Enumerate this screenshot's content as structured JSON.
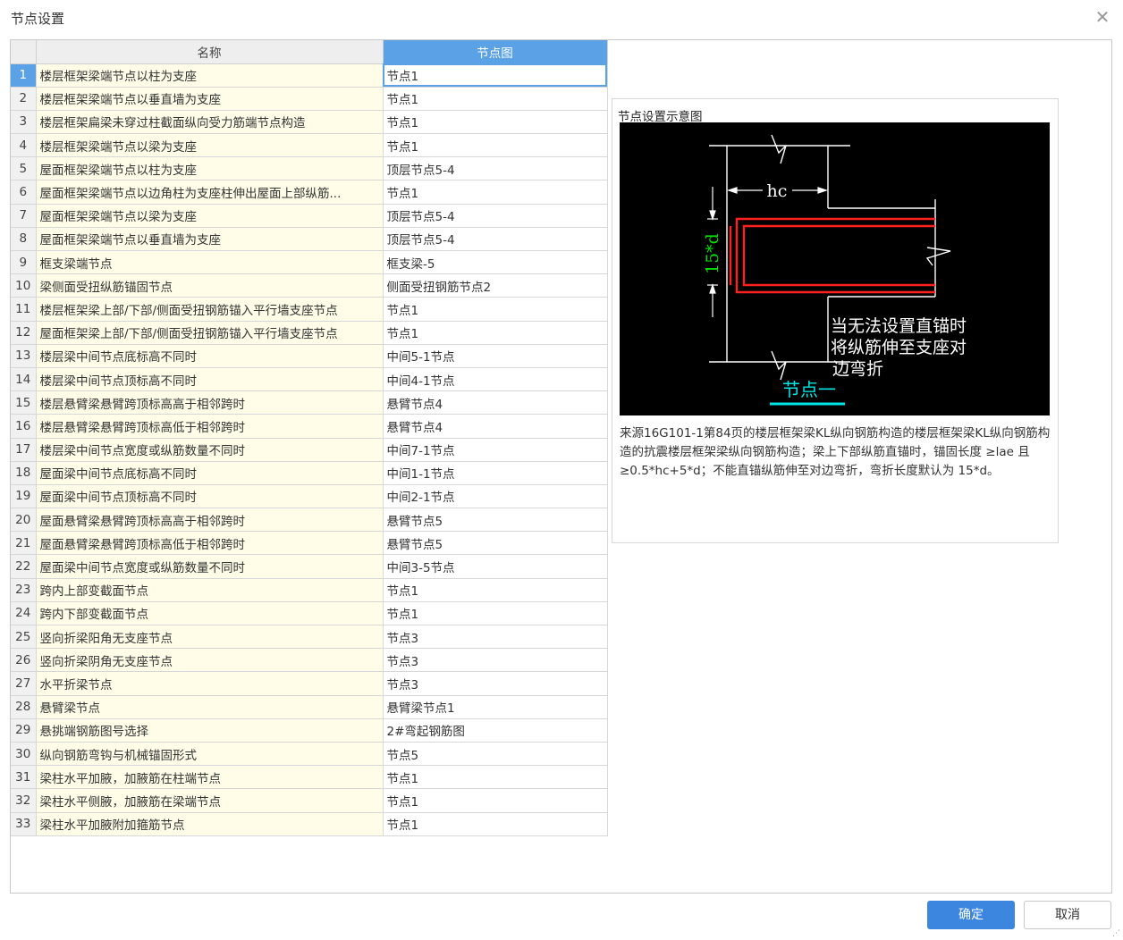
{
  "dialog": {
    "title": "节点设置"
  },
  "table": {
    "headers": {
      "name": "名称",
      "node": "节点图"
    },
    "rows": [
      {
        "no": "1",
        "name": "楼层框架梁端节点以柱为支座",
        "value": "节点1"
      },
      {
        "no": "2",
        "name": "楼层框架梁端节点以垂直墙为支座",
        "value": "节点1"
      },
      {
        "no": "3",
        "name": "楼层框架扁梁未穿过柱截面纵向受力筋端节点构造",
        "value": "节点1"
      },
      {
        "no": "4",
        "name": "楼层框架梁端节点以梁为支座",
        "value": "节点1"
      },
      {
        "no": "5",
        "name": "屋面框架梁端节点以柱为支座",
        "value": "顶层节点5-4"
      },
      {
        "no": "6",
        "name": "屋面框架梁端节点以边角柱为支座柱伸出屋面上部纵筋...",
        "value": "节点1"
      },
      {
        "no": "7",
        "name": "屋面框架梁端节点以梁为支座",
        "value": "顶层节点5-4"
      },
      {
        "no": "8",
        "name": "屋面框架梁端节点以垂直墙为支座",
        "value": "顶层节点5-4"
      },
      {
        "no": "9",
        "name": "框支梁端节点",
        "value": "框支梁-5"
      },
      {
        "no": "10",
        "name": "梁侧面受扭纵筋锚固节点",
        "value": "侧面受扭钢筋节点2"
      },
      {
        "no": "11",
        "name": "楼层框架梁上部/下部/侧面受扭钢筋锚入平行墙支座节点",
        "value": "节点1"
      },
      {
        "no": "12",
        "name": "屋面框架梁上部/下部/侧面受扭钢筋锚入平行墙支座节点",
        "value": "节点1"
      },
      {
        "no": "13",
        "name": "楼层梁中间节点底标高不同时",
        "value": "中间5-1节点"
      },
      {
        "no": "14",
        "name": "楼层梁中间节点顶标高不同时",
        "value": "中间4-1节点"
      },
      {
        "no": "15",
        "name": "楼层悬臂梁悬臂跨顶标高高于相邻跨时",
        "value": "悬臂节点4"
      },
      {
        "no": "16",
        "name": "楼层悬臂梁悬臂跨顶标高低于相邻跨时",
        "value": "悬臂节点4"
      },
      {
        "no": "17",
        "name": "楼层梁中间节点宽度或纵筋数量不同时",
        "value": "中间7-1节点"
      },
      {
        "no": "18",
        "name": "屋面梁中间节点底标高不同时",
        "value": "中间1-1节点"
      },
      {
        "no": "19",
        "name": "屋面梁中间节点顶标高不同时",
        "value": "中间2-1节点"
      },
      {
        "no": "20",
        "name": "屋面悬臂梁悬臂跨顶标高高于相邻跨时",
        "value": "悬臂节点5"
      },
      {
        "no": "21",
        "name": "屋面悬臂梁悬臂跨顶标高低于相邻跨时",
        "value": "悬臂节点5"
      },
      {
        "no": "22",
        "name": "屋面梁中间节点宽度或纵筋数量不同时",
        "value": "中间3-5节点"
      },
      {
        "no": "23",
        "name": "跨内上部变截面节点",
        "value": "节点1"
      },
      {
        "no": "24",
        "name": "跨内下部变截面节点",
        "value": "节点1"
      },
      {
        "no": "25",
        "name": "竖向折梁阳角无支座节点",
        "value": "节点3"
      },
      {
        "no": "26",
        "name": "竖向折梁阴角无支座节点",
        "value": "节点3"
      },
      {
        "no": "27",
        "name": "水平折梁节点",
        "value": "节点3"
      },
      {
        "no": "28",
        "name": "悬臂梁节点",
        "value": "悬臂梁节点1"
      },
      {
        "no": "29",
        "name": "悬挑端钢筋图号选择",
        "value": "2#弯起钢筋图"
      },
      {
        "no": "30",
        "name": "纵向钢筋弯钩与机械锚固形式",
        "value": "节点5"
      },
      {
        "no": "31",
        "name": "梁柱水平加腋，加腋筋在柱端节点",
        "value": "节点1"
      },
      {
        "no": "32",
        "name": "梁柱水平侧腋，加腋筋在梁端节点",
        "value": "节点1"
      },
      {
        "no": "33",
        "name": "梁柱水平加腋附加箍筋节点",
        "value": "节点1"
      }
    ]
  },
  "preview": {
    "title": "节点设置示意图",
    "diagram": {
      "label_hc": "hc",
      "label_d": "15*d",
      "note_lines": [
        "当无法设置直锚时",
        "将纵筋伸至支座对",
        "边弯折"
      ],
      "caption": "节点一",
      "colors": {
        "bg": "#000000",
        "line": "#ffffff",
        "rebar": "#ff2020",
        "dim": "#00e000",
        "caption": "#00e5e5"
      }
    },
    "description": "来源16G101-1第84页的楼层框架梁KL纵向钢筋构造的楼层框架梁KL纵向钢筋构造的抗震楼层框架梁纵向钢筋构造；梁上下部纵筋直锚时，锚固长度 ≥lae 且 ≥0.5*hc+5*d；不能直锚纵筋伸至对边弯折，弯折长度默认为 15*d。"
  },
  "buttons": {
    "ok": "确定",
    "cancel": "取消"
  },
  "colors": {
    "accent": "#5ba1e5",
    "ok_button": "#3d86e0",
    "name_cell_bg": "#fffde8"
  }
}
